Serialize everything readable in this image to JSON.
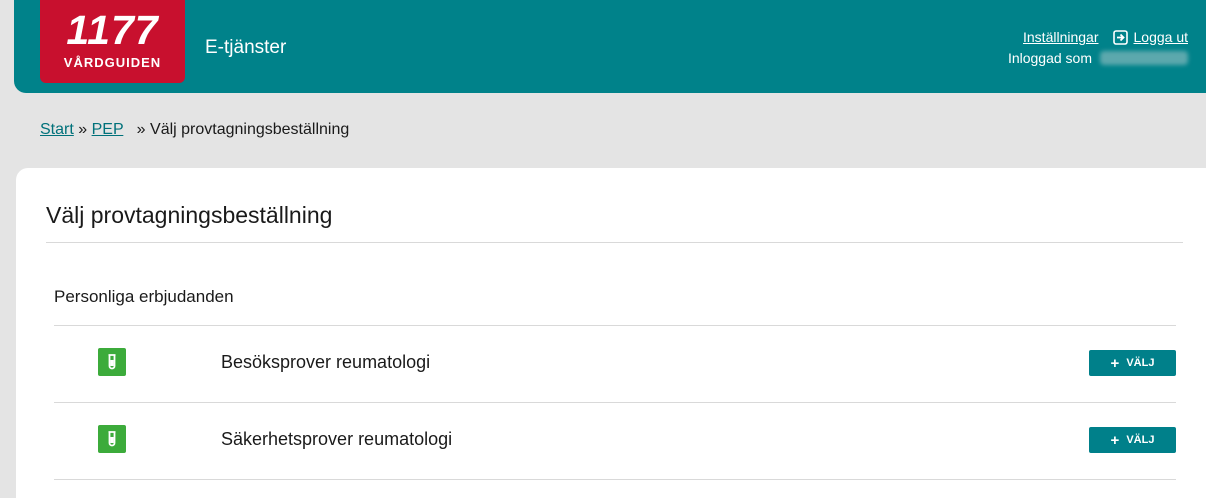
{
  "header": {
    "logo_number": "1177",
    "logo_text": "VÅRDGUIDEN",
    "service_name": "E-tjänster",
    "settings_link": "Inställningar",
    "logout_link": "Logga ut",
    "logged_in_as": "Inloggad som"
  },
  "breadcrumb": {
    "items": [
      "Start",
      "PEP"
    ],
    "current": "Välj provtagningsbeställning"
  },
  "page": {
    "title": "Välj provtagningsbeställning",
    "section_title": "Personliga erbjudanden",
    "offers": [
      {
        "label": "Besöksprover reumatologi",
        "button": "VÄLJ"
      },
      {
        "label": "Säkerhetsprover reumatologi",
        "button": "VÄLJ"
      }
    ]
  },
  "colors": {
    "header_bg": "#00828a",
    "logo_bg": "#c8102e",
    "icon_green": "#3cab3b",
    "button_bg": "#00808a"
  },
  "icons": {
    "logout": "logout-icon",
    "offer": "test-tube-icon",
    "button": "plus-icon"
  }
}
